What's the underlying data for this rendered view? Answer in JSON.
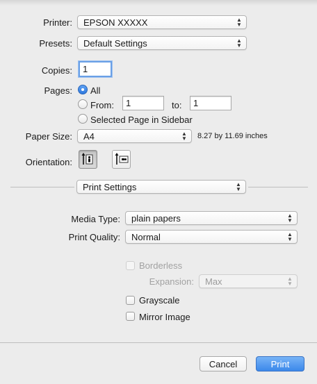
{
  "printer": {
    "label": "Printer:",
    "value": "EPSON XXXXX"
  },
  "presets": {
    "label": "Presets:",
    "value": "Default Settings"
  },
  "copies": {
    "label": "Copies:",
    "value": "1"
  },
  "pages": {
    "label": "Pages:",
    "all_label": "All",
    "from_label": "From:",
    "from_value": "1",
    "to_label": "to:",
    "to_value": "1",
    "selected_page_label": "Selected Page in Sidebar",
    "selected_option": "All"
  },
  "paper_size": {
    "label": "Paper Size:",
    "value": "A4",
    "dimensions": "8.27 by 11.69 inches"
  },
  "orientation": {
    "label": "Orientation:",
    "selected": "portrait"
  },
  "section": {
    "value": "Print Settings"
  },
  "media_type": {
    "label": "Media Type:",
    "value": "plain papers"
  },
  "print_quality": {
    "label": "Print Quality:",
    "value": "Normal"
  },
  "borderless": {
    "label": "Borderless",
    "checked": false,
    "enabled": false
  },
  "expansion": {
    "label": "Expansion:",
    "value": "Max",
    "enabled": false
  },
  "grayscale": {
    "label": "Grayscale",
    "checked": false
  },
  "mirror_image": {
    "label": "Mirror Image",
    "checked": false
  },
  "buttons": {
    "cancel": "Cancel",
    "print": "Print"
  }
}
